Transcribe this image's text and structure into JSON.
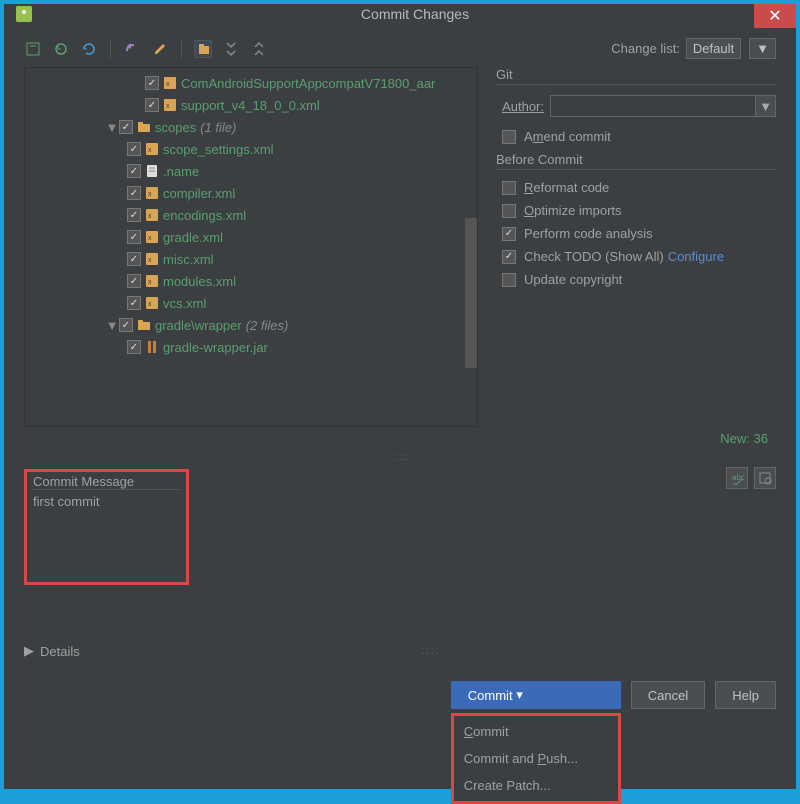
{
  "window": {
    "title": "Commit Changes"
  },
  "toolbar": {
    "changeListLabel": "Change list:",
    "changeListValue": "Default"
  },
  "tree": {
    "items": [
      {
        "indent": 3,
        "checked": true,
        "icon": "xml",
        "label": "ComAndroidSupportAppcompatV71800_aar"
      },
      {
        "indent": 3,
        "checked": true,
        "icon": "xml",
        "label": "support_v4_18_0_0.xml"
      },
      {
        "indent": 1,
        "expanded": true,
        "checked": true,
        "icon": "folder",
        "label": "scopes",
        "count": "(1 file)"
      },
      {
        "indent": 2,
        "checked": true,
        "icon": "xml",
        "label": "scope_settings.xml"
      },
      {
        "indent": 2,
        "checked": true,
        "icon": "txt",
        "label": ".name"
      },
      {
        "indent": 2,
        "checked": true,
        "icon": "xml",
        "label": "compiler.xml"
      },
      {
        "indent": 2,
        "checked": true,
        "icon": "xml",
        "label": "encodings.xml"
      },
      {
        "indent": 2,
        "checked": true,
        "icon": "xml",
        "label": "gradle.xml"
      },
      {
        "indent": 2,
        "checked": true,
        "icon": "xml",
        "label": "misc.xml"
      },
      {
        "indent": 2,
        "checked": true,
        "icon": "xml",
        "label": "modules.xml"
      },
      {
        "indent": 2,
        "checked": true,
        "icon": "xml",
        "label": "vcs.xml"
      },
      {
        "indent": 1,
        "expanded": true,
        "checked": true,
        "icon": "folder",
        "label": "gradle\\wrapper",
        "count": "(2 files)"
      },
      {
        "indent": 2,
        "checked": true,
        "icon": "jar",
        "label": "gradle-wrapper.jar"
      }
    ],
    "newCount": "New: 36"
  },
  "git": {
    "title": "Git",
    "authorLabel": "Author:",
    "amendLabel": "Amend commit",
    "beforeCommitTitle": "Before Commit",
    "reformat": {
      "checked": false,
      "label": "Reformat code"
    },
    "optimize": {
      "checked": false,
      "label": "Optimize imports"
    },
    "analysis": {
      "checked": true,
      "label": "Perform code analysis"
    },
    "todo": {
      "checked": true,
      "label": "Check TODO (Show All)"
    },
    "configureLabel": "Configure",
    "copyright": {
      "checked": false,
      "label": "Update copyright"
    }
  },
  "commitMessage": {
    "label": "Commit Message",
    "value": "first commit"
  },
  "detailsLabel": "Details",
  "buttons": {
    "commit": "Commit",
    "cancel": "Cancel",
    "help": "Help"
  },
  "dropdown": {
    "commit": "Commit",
    "commitPush": "Commit and Push...",
    "patch": "Create Patch..."
  }
}
